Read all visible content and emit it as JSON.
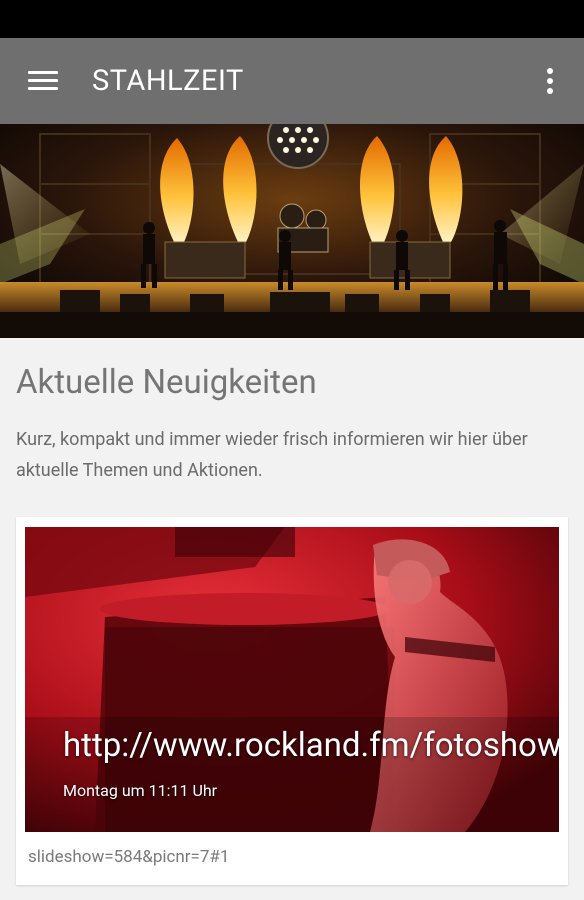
{
  "appbar": {
    "title": "STAHLZEIT"
  },
  "section": {
    "title": "Aktuelle Neuigkeiten",
    "description": "Kurz, kompakt und immer wieder frisch informieren wir hier über aktuelle Themen und Aktionen."
  },
  "news_card": {
    "headline": "http://www.rockland.fm/fotoshow",
    "date": "Montag um 11:11 Uhr",
    "url_text": "slideshow=584&picnr=7#1"
  }
}
